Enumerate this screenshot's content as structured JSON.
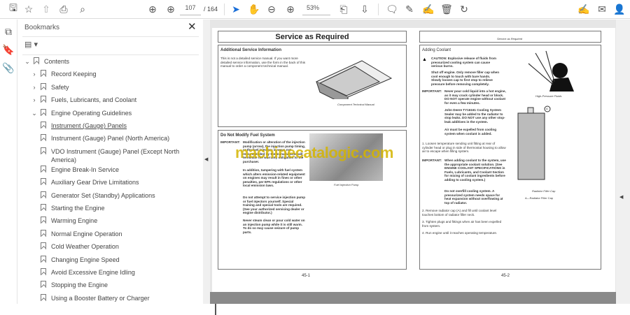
{
  "toolbar": {
    "page_current": "107",
    "page_total": "/ 164",
    "zoom": "53%"
  },
  "panel": {
    "title": "Bookmarks",
    "close": "✕"
  },
  "bookmarks": [
    {
      "label": "Contents",
      "level": 0,
      "state": "expanded"
    },
    {
      "label": "Record Keeping",
      "level": 1,
      "state": "collapsed"
    },
    {
      "label": "Safety",
      "level": 1,
      "state": "collapsed"
    },
    {
      "label": "Fuels, Lubricants, and Coolant",
      "level": 1,
      "state": "collapsed"
    },
    {
      "label": "Engine Operating Guidelines",
      "level": 1,
      "state": "expanded"
    },
    {
      "label": "Instrument (Gauge) Panels",
      "level": 2
    },
    {
      "label": "Instrument (Gauge) Panel (North America)",
      "level": 2
    },
    {
      "label": "VDO Instrument (Gauge) Panel (Except North America)",
      "level": 2
    },
    {
      "label": "Engine Break-In Service",
      "level": 2
    },
    {
      "label": "Auxiliary Gear Drive Limitations",
      "level": 2
    },
    {
      "label": "Generator Set (Standby) Applications",
      "level": 2
    },
    {
      "label": "Starting the Engine",
      "level": 2
    },
    {
      "label": "Warming Engine",
      "level": 2
    },
    {
      "label": "Normal Engine Operation",
      "level": 2
    },
    {
      "label": "Cold Weather Operation",
      "level": 2
    },
    {
      "label": "Changing Engine Speed",
      "level": 2
    },
    {
      "label": "Avoid Excessive Engine Idling",
      "level": 2
    },
    {
      "label": "Stopping the Engine",
      "level": 2
    },
    {
      "label": "Using a Booster Battery or Charger",
      "level": 2
    }
  ],
  "page1": {
    "title": "Service as Required",
    "s1_heading": "Additional Service Information",
    "s1_text": "This is not a detailed service manual. If you want more detailed service information, use the form in the back of this manual to order a component technical manual.",
    "s1_caption": "Component Technical Manual",
    "s2_heading": "Do Not Modify Fuel System",
    "important": "IMPORTANT:",
    "s2_p1": "Modification or alteration of the injection pump (arrow), the injection pump timing, or the fuel injectors in ways not recommended by the manufacturer will terminate the warranty obligation to the purchaser.",
    "s2_p2": "In addition, tampering with fuel system which alters emission-related equipment on engines may result in fines or other penalties, per EPA regulations or other local emission laws.",
    "s2_p3": "Do not attempt to service injection pump or fuel injectors yourself. Special training and special tools are required. (See your authorized servicing dealer or engine distributor.)",
    "s2_p4": "Never steam clean or pour cold water on an injection pump while it is still warm. To do so may cause seizure of pump parts.",
    "s2_caption": "Fuel Injection Pump",
    "page_number": "45-1",
    "watermark": "machinecatalogic.com"
  },
  "page2": {
    "header": "Service as Required",
    "heading": "Adding Coolant",
    "caution": "CAUTION: Explosive release of fluids from pressurized cooling system can cause serious burns.",
    "caution2": "Shut off engine. Only remove filler cap when cool enough to touch with bare hands. Slowly loosen cap to first stop to relieve pressure before removing completely.",
    "important": "IMPORTANT:",
    "imp1": "Never pour cold liquid into a hot engine, as it may crack cylinder head or block. DO NOT operate engine without coolant for even a few minutes.",
    "imp1b": "John Deere TY16161 Cooling System Sealer may be added to the radiator to stop leaks. DO NOT use any other stop-leak additives in the system.",
    "imp1c": "Air must be expelled from cooling system when coolant is added.",
    "step1": "1. Loosen temperature sending unit fitting at rear of cylinder head or plug in side of thermostat housing to allow air to escape when filling system.",
    "imp2": "When adding coolant to the system, use the appropriate coolant solution. (See ENGINE COOLANT SPECIFICATIONS in Fuels, Lubricants, and Coolant Section for mixing of coolant ingredients before adding to cooling system.)",
    "imp2b": "Do not overfill cooling system. A pressurized system needs space for heat expansion without overflowing at top of radiator.",
    "step2": "2. Remove radiator cap (A) and fill until coolant level touches bottom of radiator filler neck.",
    "step3": "3. Tighten plugs and fittings when air has been expelled from system.",
    "step4": "4. Run engine until it reaches operating temperature.",
    "cap1": "High-Pressure Fluids",
    "cap2": "Radiator Filler Cap",
    "cap3": "A—Radiator Filler Cap",
    "callout": "A",
    "page_number": "45-2"
  }
}
